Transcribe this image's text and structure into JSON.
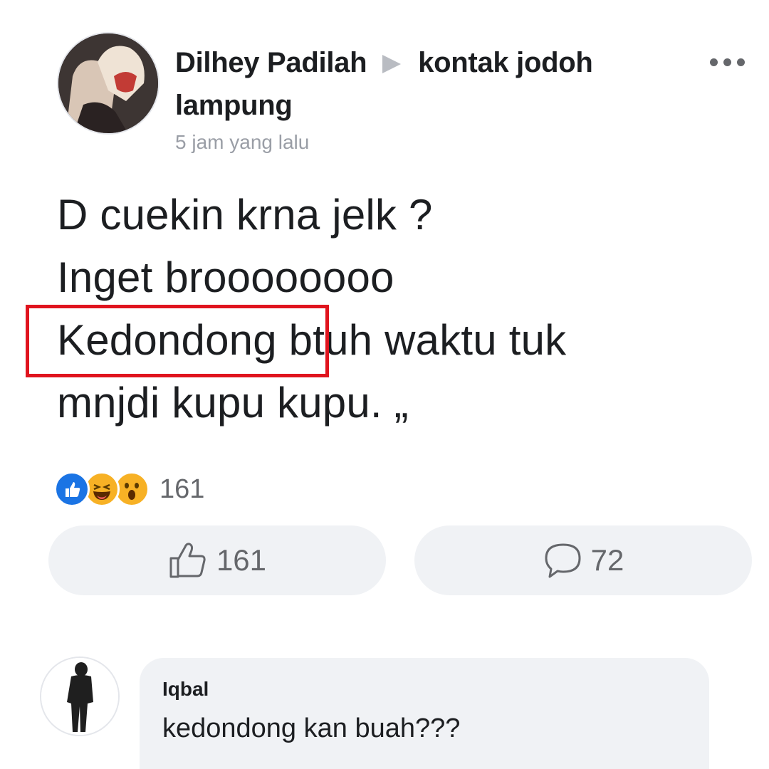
{
  "post": {
    "author": "Dilhey Padilah",
    "group": "kontak jodoh",
    "group_cont": "lampung",
    "timestamp": "5 jam yang lalu",
    "lines": [
      "D cuekin krna jelk ?",
      "Inget broooooooo",
      "Kedondong btuh waktu tuk",
      "mnjdi kupu kupu. „"
    ],
    "reactions": {
      "icons": [
        "like-icon",
        "haha-icon",
        "wow-icon"
      ],
      "count": "161"
    },
    "like_count": "161",
    "comment_count": "72"
  },
  "comment": {
    "author": "Iqbal",
    "text": "kedondong kan buah???",
    "text_partial": ""
  },
  "colors": {
    "like_blue": "#1b74e4",
    "emoji_yellow": "#f7b125",
    "highlight_red": "#e0141e",
    "button_bg": "#f0f2f5",
    "secondary_text": "#65676b"
  }
}
